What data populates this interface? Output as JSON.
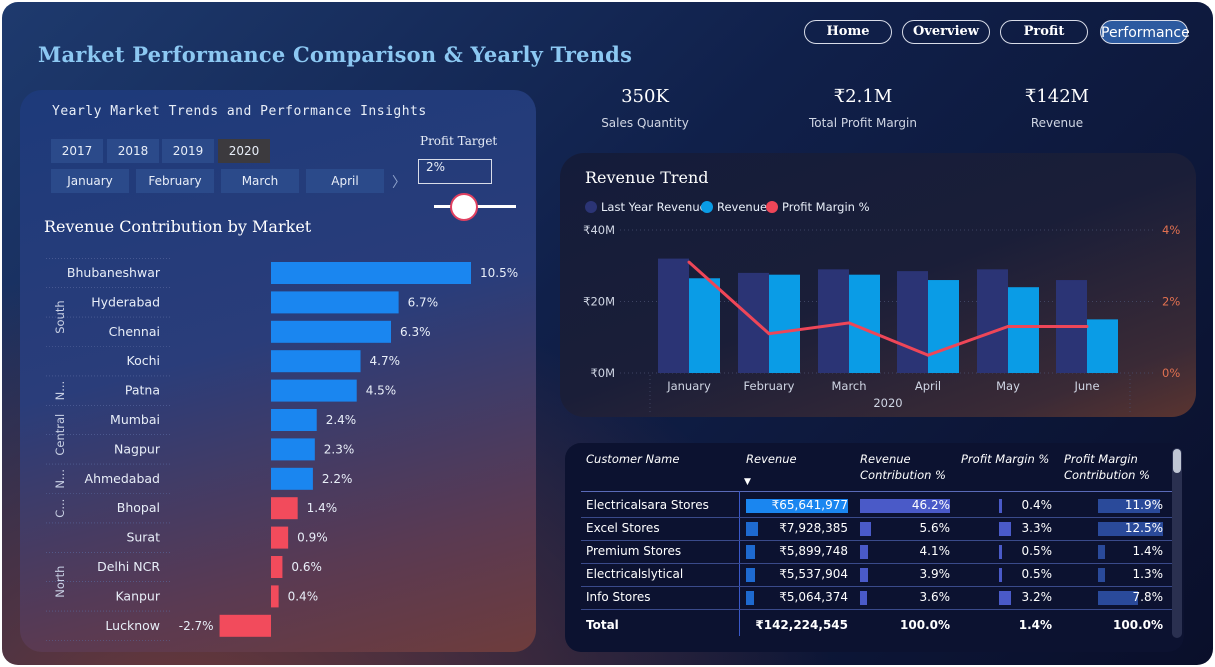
{
  "title": "Market Performance Comparison & Yearly Trends",
  "nav": {
    "home": "Home",
    "overview": "Overview",
    "profit": "Profit",
    "performance": "Performance"
  },
  "left_panel": {
    "title": "Yearly Market Trends and Performance Insights",
    "years": [
      "2017",
      "2018",
      "2019",
      "2020"
    ],
    "selected_year": "2020",
    "months": [
      "January",
      "February",
      "March",
      "April"
    ],
    "profit_target_label": "Profit Target",
    "profit_target_value": "2%",
    "slider_level_percent": 37
  },
  "kpis": [
    {
      "value": "350K",
      "label": "Sales Quantity"
    },
    {
      "value": "₹2.1M",
      "label": "Total Profit Margin"
    },
    {
      "value": "₹142M",
      "label": "Revenue"
    }
  ],
  "colors": {
    "positive": "#1a86f0",
    "negative": "#f24b5c",
    "last_year": "#2b3475",
    "revenue": "#0a9ce6",
    "margin": "#ee4658"
  },
  "chart_data": [
    {
      "type": "bar",
      "title": "Revenue Contribution by Market",
      "orientation": "horizontal",
      "groups": [
        {
          "name": "South",
          "categories": [
            "Bhubaneshwar",
            "Hyderabad",
            "Chennai",
            "Kochi"
          ]
        },
        {
          "name": "N...",
          "categories": [
            "Patna"
          ]
        },
        {
          "name": "Central",
          "categories": [
            "Mumbai",
            "Nagpur"
          ]
        },
        {
          "name": "N...",
          "categories": [
            "Ahmedabad"
          ]
        },
        {
          "name": "C...",
          "categories": [
            "Bhopal"
          ]
        },
        {
          "name": "North",
          "categories": [
            "Surat",
            "Delhi NCR",
            "Kanpur",
            "Lucknow"
          ]
        }
      ],
      "categories": [
        "Bhubaneshwar",
        "Hyderabad",
        "Chennai",
        "Kochi",
        "Patna",
        "Mumbai",
        "Nagpur",
        "Ahmedabad",
        "Bhopal",
        "Surat",
        "Delhi NCR",
        "Kanpur",
        "Lucknow"
      ],
      "values": [
        10.5,
        6.7,
        6.3,
        4.7,
        4.5,
        2.4,
        2.3,
        2.2,
        1.4,
        0.9,
        0.6,
        0.4,
        -2.7
      ],
      "labels": [
        "10.5%",
        "6.7%",
        "6.3%",
        "4.7%",
        "4.5%",
        "2.4%",
        "2.3%",
        "2.2%",
        "1.4%",
        "0.9%",
        "0.6%",
        "0.4%",
        "-2.7%"
      ],
      "threshold": 2
    },
    {
      "type": "bar",
      "title": "Revenue Trend",
      "categories": [
        "January",
        "February",
        "March",
        "April",
        "May",
        "June"
      ],
      "x_group_label": "2020",
      "series": [
        {
          "name": "Last Year Revenue",
          "values": [
            32,
            28,
            29,
            28.5,
            29,
            26
          ]
        },
        {
          "name": "Revenue",
          "values": [
            26.5,
            27.5,
            27.5,
            26,
            24,
            15
          ]
        },
        {
          "name": "Profit Margin %",
          "axis": "right",
          "values": [
            3.1,
            1.1,
            1.4,
            0.5,
            1.3,
            1.3
          ]
        }
      ],
      "yticks_left": [
        "₹0M",
        "₹20M",
        "₹40M"
      ],
      "ylim_left": [
        0,
        40
      ],
      "yticks_right": [
        "0%",
        "2%",
        "4%"
      ],
      "ylim_right": [
        0,
        4
      ],
      "legend": "top-left"
    }
  ],
  "table": {
    "headers": [
      "Customer Name",
      "Revenue",
      "Revenue Contribution %",
      "Profit Margin %",
      "Profit Margin Contribution %"
    ],
    "rows": [
      {
        "name": "Electricalsara Stores",
        "revenue": "₹65,641,977",
        "rev_contrib": "46.2%",
        "margin": "0.4%",
        "margin_contrib": "11.9%",
        "rev_frac": 1.0,
        "rc_frac": 1.0,
        "m_frac": 0.12,
        "mc_frac": 0.95
      },
      {
        "name": "Excel Stores",
        "revenue": "₹7,928,385",
        "rev_contrib": "5.6%",
        "margin": "3.3%",
        "margin_contrib": "12.5%",
        "rev_frac": 0.12,
        "rc_frac": 0.12,
        "m_frac": 1.0,
        "mc_frac": 1.0
      },
      {
        "name": "Premium Stores",
        "revenue": "₹5,899,748",
        "rev_contrib": "4.1%",
        "margin": "0.5%",
        "margin_contrib": "1.4%",
        "rev_frac": 0.09,
        "rc_frac": 0.09,
        "m_frac": 0.15,
        "mc_frac": 0.11
      },
      {
        "name": "Electricalslytical",
        "revenue": "₹5,537,904",
        "rev_contrib": "3.9%",
        "margin": "0.5%",
        "margin_contrib": "1.3%",
        "rev_frac": 0.085,
        "rc_frac": 0.085,
        "m_frac": 0.15,
        "mc_frac": 0.1
      },
      {
        "name": "Info Stores",
        "revenue": "₹5,064,374",
        "rev_contrib": "3.6%",
        "margin": "3.2%",
        "margin_contrib": "7.8%",
        "rev_frac": 0.077,
        "rc_frac": 0.077,
        "m_frac": 0.97,
        "mc_frac": 0.62
      }
    ],
    "total": {
      "name": "Total",
      "revenue": "₹142,224,545",
      "rev_contrib": "100.0%",
      "margin": "1.4%",
      "margin_contrib": "100.0%"
    }
  }
}
